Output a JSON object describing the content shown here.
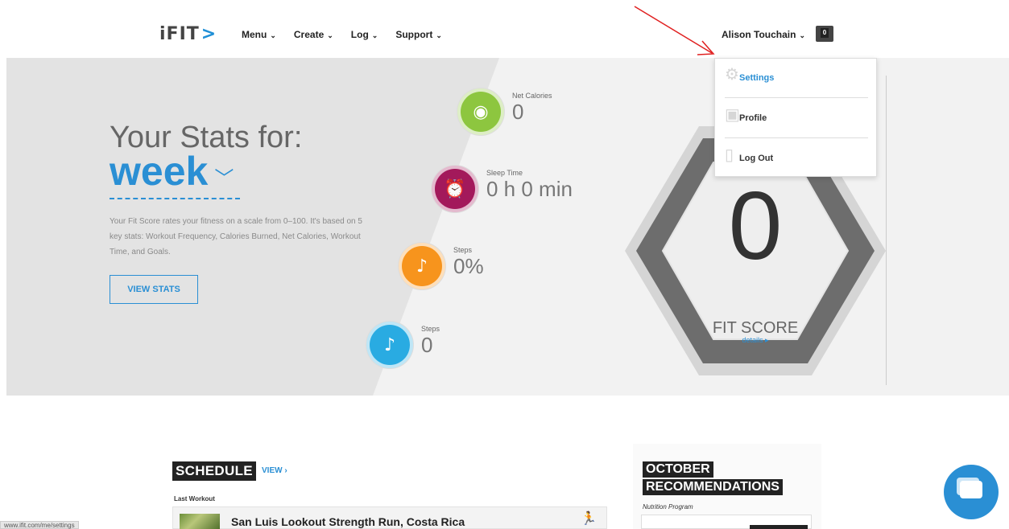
{
  "header": {
    "logo": "iFIT",
    "logo_mark": ">",
    "nav": [
      {
        "label": "Menu"
      },
      {
        "label": "Create"
      },
      {
        "label": "Log"
      },
      {
        "label": "Support"
      }
    ],
    "user_name": "Alison Touchain",
    "cart_count": "0"
  },
  "dropdown": {
    "items": [
      {
        "label": "Settings",
        "icon": "gear-icon"
      },
      {
        "label": "Profile",
        "icon": "person-icon"
      },
      {
        "label": "Log Out",
        "icon": "door-icon"
      }
    ]
  },
  "hero": {
    "title": "Your Stats for:",
    "period": "week",
    "description": "Your Fit Score rates your fitness on a scale from 0–100. It's based on 5 key stats: Workout Frequency, Calories Burned, Net Calories, Workout Time, and Goals.",
    "view_stats": "VIEW STATS",
    "stats": [
      {
        "label": "Net Calories",
        "value": "0",
        "color": "#8dc63f",
        "icon": "flame-icon"
      },
      {
        "label": "Sleep Time",
        "value": "0 h  0 min",
        "color": "#a3195b",
        "icon": "alarm-clock-icon"
      },
      {
        "label": "Steps",
        "value": "0%",
        "color": "#f7941d",
        "icon": "footprint-icon"
      },
      {
        "label": "Steps",
        "value": "0",
        "color": "#29abe2",
        "icon": "footprint-icon"
      }
    ],
    "fit_score": "0",
    "fit_label": "FIT SCORE",
    "fit_details": "details ▸"
  },
  "schedule": {
    "title": "SCHEDULE",
    "view": "VIEW ›",
    "last_workout_label": "Last Workout",
    "workout_title": "San Luis Lookout Strength Run, Costa Rica"
  },
  "recommendations": {
    "title1": "OCTOBER",
    "title2": "RECOMMENDATIONS",
    "subtitle": "Nutrition Program"
  },
  "status_url": "www.ifit.com/me/settings",
  "colors": {
    "accent": "#2a8fd4",
    "annotation_arrow": "#e02020"
  }
}
